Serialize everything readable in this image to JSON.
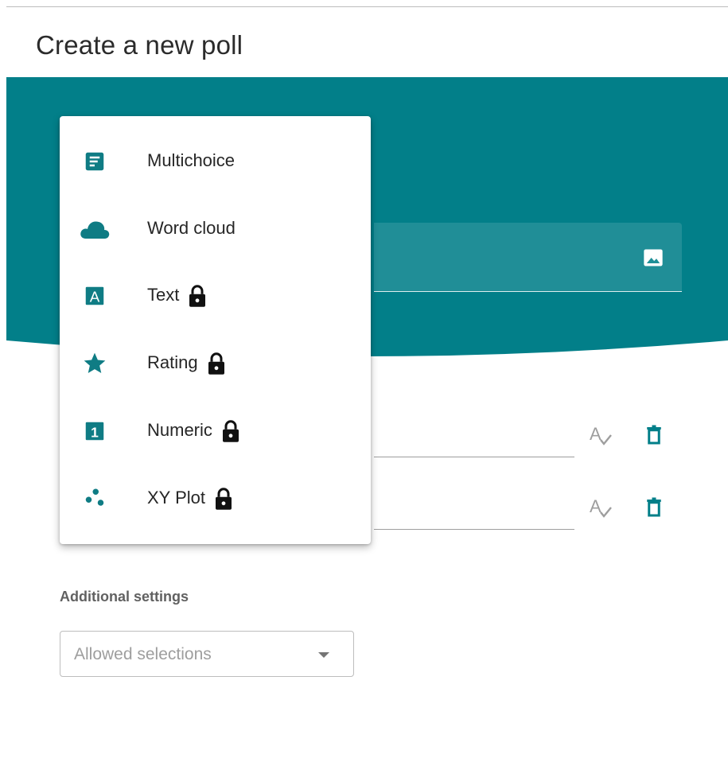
{
  "page": {
    "title": "Create a new poll"
  },
  "colors": {
    "accent": "#027f89",
    "hero_background": "#027f89",
    "menu_icon": "#0f7c84"
  },
  "question": {
    "image_icon": "image-icon"
  },
  "options": [
    {
      "spellcheck_icon": "spellcheck-icon",
      "delete_icon": "trash-icon"
    },
    {
      "spellcheck_icon": "spellcheck-icon",
      "delete_icon": "trash-icon"
    }
  ],
  "menu": {
    "items": [
      {
        "label": "Multichoice",
        "icon": "multichoice-icon",
        "locked": false
      },
      {
        "label": "Word cloud",
        "icon": "cloud-icon",
        "locked": false
      },
      {
        "label": "Text",
        "icon": "text-icon",
        "locked": true
      },
      {
        "label": "Rating",
        "icon": "star-icon",
        "locked": true
      },
      {
        "label": "Numeric",
        "icon": "numeric-icon",
        "locked": true
      },
      {
        "label": "XY Plot",
        "icon": "scatter-icon",
        "locked": true
      }
    ]
  },
  "settings": {
    "label": "Additional settings",
    "allowed_selections": {
      "placeholder": "Allowed selections",
      "value": ""
    }
  }
}
